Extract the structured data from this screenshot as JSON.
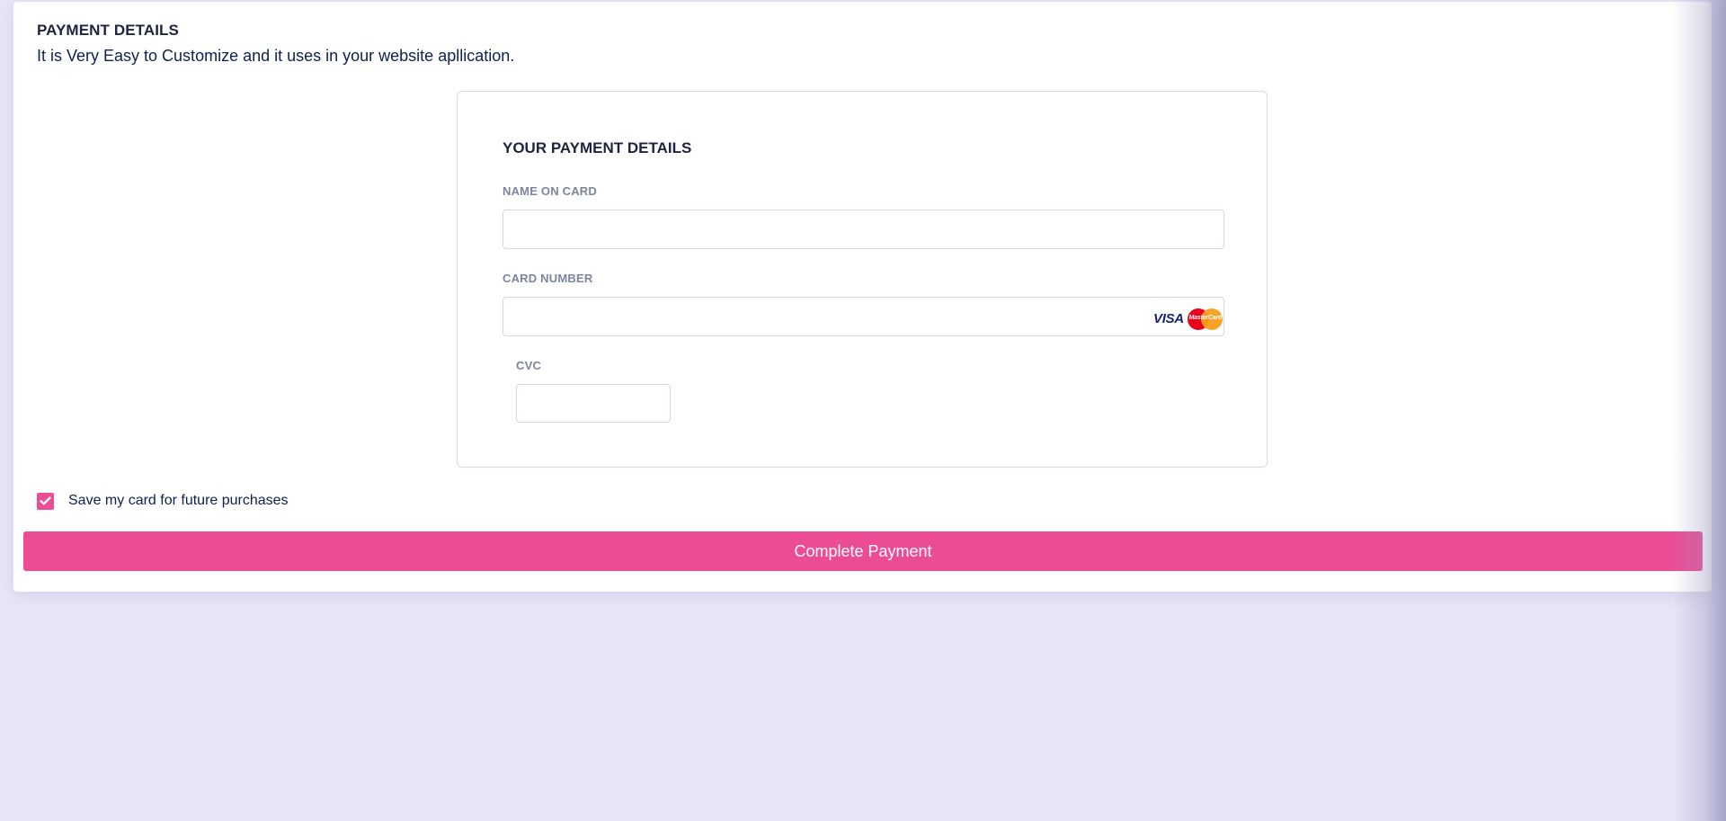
{
  "page": {
    "title": "PAYMENT DETAILS",
    "subtitle": "It is Very Easy to Customize and it uses in your website apllication."
  },
  "card_form": {
    "heading": "YOUR PAYMENT DETAILS",
    "name_label": "NAME ON CARD",
    "name_value": "",
    "number_label": "CARD NUMBER",
    "number_value": "",
    "cvc_label": "CVC",
    "cvc_value": "",
    "logos": {
      "visa": "VISA",
      "mastercard": "MasterCard"
    }
  },
  "save_card": {
    "label": "Save my card for future purchases",
    "checked": true
  },
  "submit": {
    "label": "Complete Payment"
  },
  "colors": {
    "accent": "#ec4c94",
    "background": "#e8e6f6",
    "heading": "#1f2340",
    "label": "#7d859e"
  }
}
